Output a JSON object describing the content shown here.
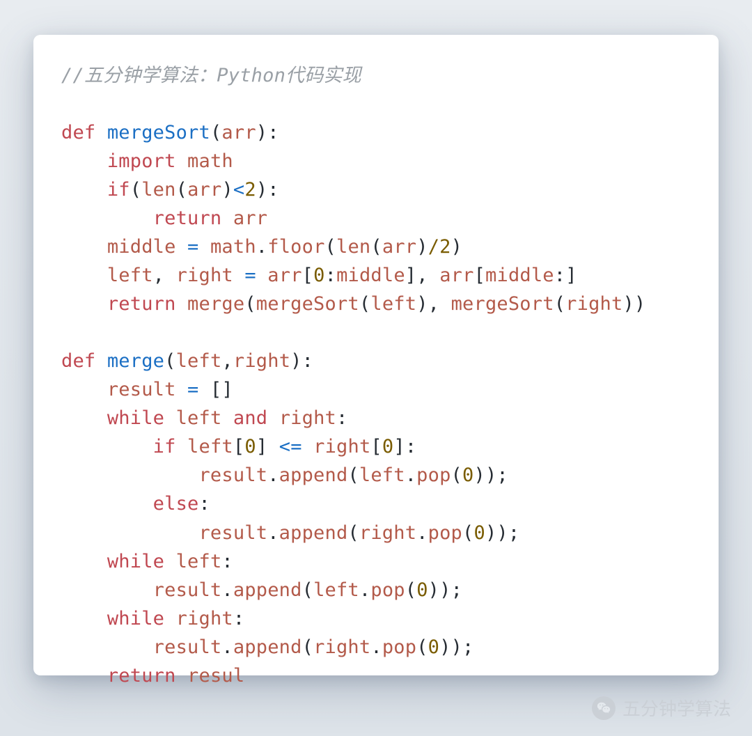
{
  "comment": "//五分钟学算法：Python代码实现",
  "code": {
    "fn1": {
      "def": "def",
      "name": "mergeSort",
      "param": "arr",
      "l1_import": "import",
      "l1_math": "math",
      "l2_if": "if",
      "l2_len": "len",
      "l2_arr": "arr",
      "l2_lt": "<",
      "l2_two": "2",
      "l3_return": "return",
      "l3_arr": "arr",
      "l4_middle": "middle",
      "l4_eq": "=",
      "l4_math": "math",
      "l4_floor": "floor",
      "l4_len": "len",
      "l4_arr": "arr",
      "l4_slash2": "/2",
      "l5_left": "left",
      "l5_right": "right",
      "l5_eq": "=",
      "l5_arr1": "arr",
      "l5_zero": "0",
      "l5_middle1": "middle",
      "l5_arr2": "arr",
      "l5_middle2": "middle",
      "l6_return": "return",
      "l6_merge": "merge",
      "l6_ms1": "mergeSort",
      "l6_left": "left",
      "l6_ms2": "mergeSort",
      "l6_right": "right"
    },
    "fn2": {
      "def": "def",
      "name": "merge",
      "p_left": "left",
      "p_right": "right",
      "r_result": "result",
      "r_eq": "=",
      "w1_while": "while",
      "w1_left": "left",
      "w1_and": "and",
      "w1_right": "right",
      "if_if": "if",
      "if_left": "left",
      "if_zero1": "0",
      "if_le": "<=",
      "if_right": "right",
      "if_zero2": "0",
      "ap1_result": "result",
      "ap1_append": "append",
      "ap1_left": "left",
      "ap1_pop": "pop",
      "ap1_zero": "0",
      "else": "else",
      "ap2_result": "result",
      "ap2_append": "append",
      "ap2_right": "right",
      "ap2_pop": "pop",
      "ap2_zero": "0",
      "w2_while": "while",
      "w2_left": "left",
      "ap3_result": "result",
      "ap3_append": "append",
      "ap3_left": "left",
      "ap3_pop": "pop",
      "ap3_zero": "0",
      "w3_while": "while",
      "w3_right": "right",
      "ap4_result": "result",
      "ap4_append": "append",
      "ap4_right": "right",
      "ap4_pop": "pop",
      "ap4_zero": "0",
      "ret_return": "return",
      "ret_resul": "resul"
    }
  },
  "watermark": "五分钟学算法"
}
